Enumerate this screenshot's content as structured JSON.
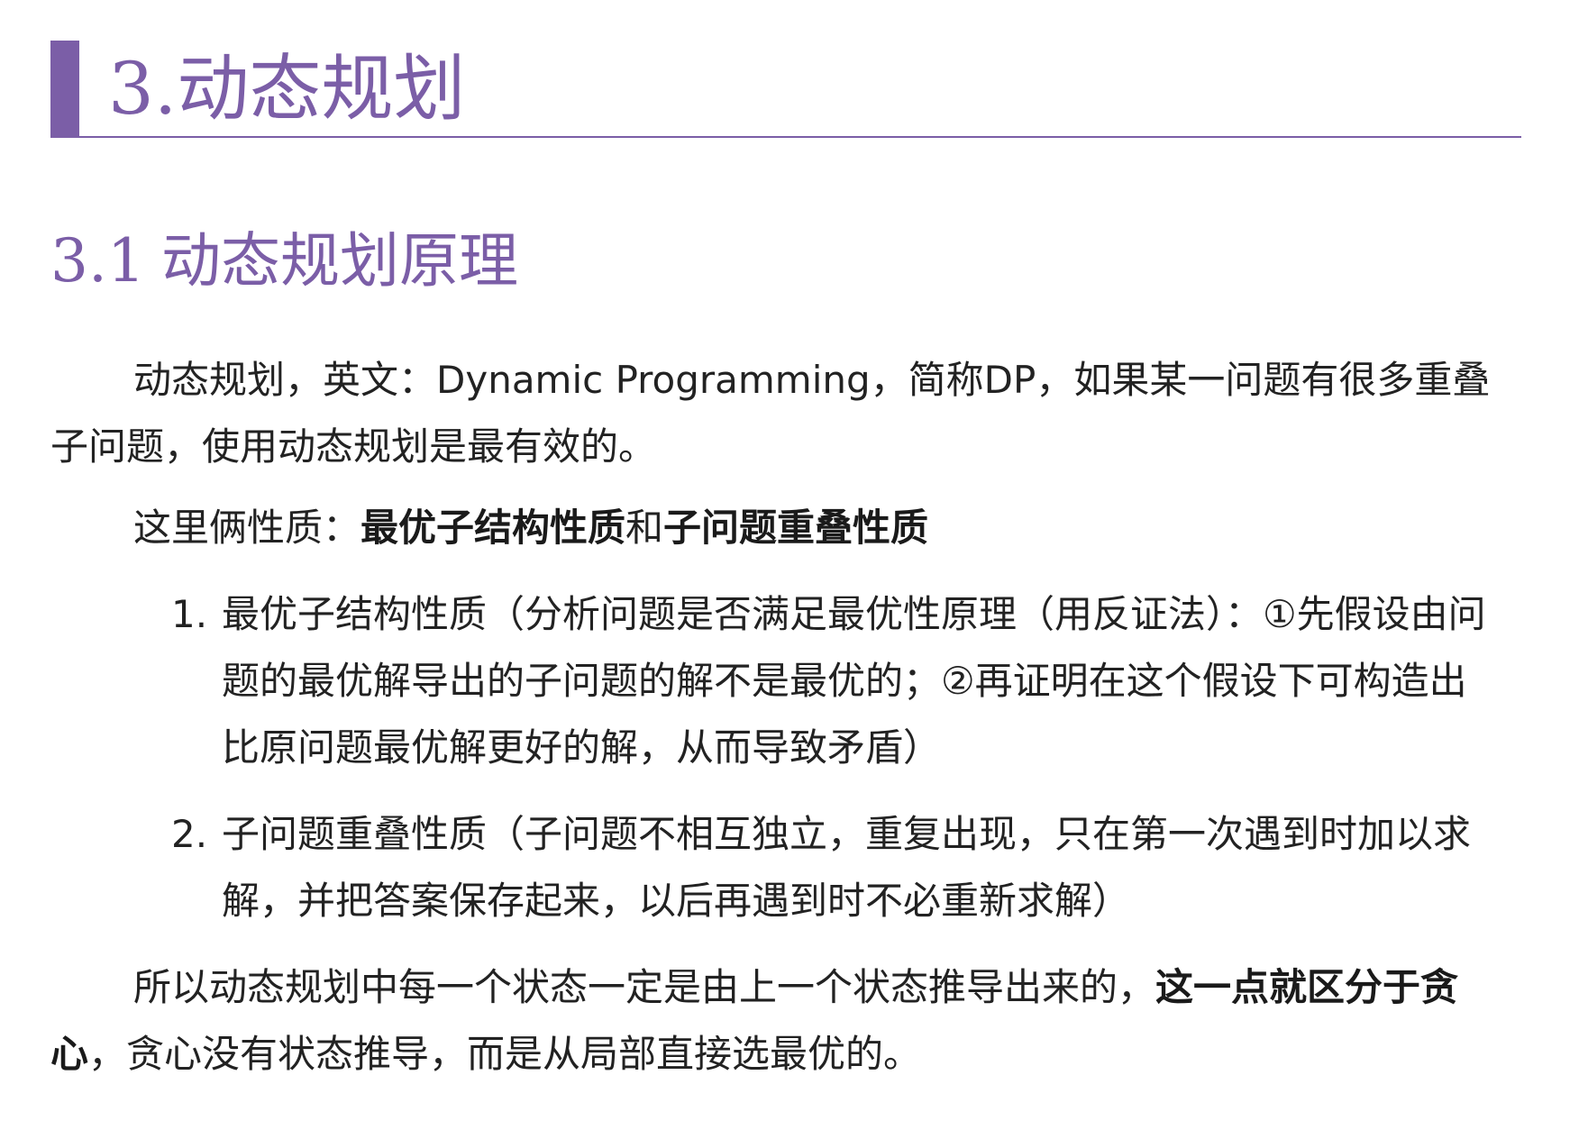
{
  "chapter": {
    "title": "3.动态规划",
    "accent_color": "#7b5ea7"
  },
  "section": {
    "number": "3.1",
    "title": "动态规划原理"
  },
  "paragraphs": {
    "intro": "动态规划，英文：Dynamic Programming，简称DP，如果某一问题有很多重叠子问题，使用动态规划是最有效的。",
    "properties": {
      "prefix": "这里俩性质：",
      "prop1": "最优子结构性质",
      "joiner": "和",
      "prop2": "子问题重叠性质"
    },
    "conclusion": {
      "text": "所以动态规划中每一个状态一定是由上一个状态推导出来的，",
      "bold": "这一点就区分于贪心",
      "rest": "，贪心没有状态推导，而是从局部直接选最优的。"
    }
  },
  "list": [
    {
      "marker": "1.",
      "text": "最优子结构性质（分析问题是否满足最优性原理（用反证法）：①先假设由问题的最优解导出的子问题的解不是最优的；②再证明在这个假设下可构造出比原问题最优解更好的解，从而导致矛盾）"
    },
    {
      "marker": "2.",
      "text": "子问题重叠性质（子问题不相互独立，重复出现，只在第一次遇到时加以求解，并把答案保存起来，以后再遇到时不必重新求解）"
    }
  ]
}
